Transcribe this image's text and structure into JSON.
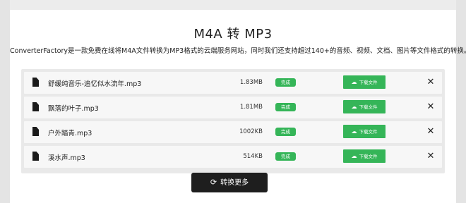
{
  "page": {
    "title": "M4A 转 MP3",
    "subtitle": "ConverterFactory是一款免费在线将M4A文件转换为MP3格式的云端服务网站，同时我们还支持超过140+的音频、视频、文档、图片等文件格式的转换。"
  },
  "files": [
    {
      "name": "舒缓纯音乐-追忆似水流年.mp3",
      "size": "1.83MB",
      "status": "完成",
      "download_label": "下载文件"
    },
    {
      "name": "飘落的叶子.mp3",
      "size": "1.81MB",
      "status": "完成",
      "download_label": "下载文件"
    },
    {
      "name": "户外踏青.mp3",
      "size": "1002KB",
      "status": "完成",
      "download_label": "下载文件"
    },
    {
      "name": "溪水声.mp3",
      "size": "514KB",
      "status": "完成",
      "download_label": "下载文件"
    }
  ],
  "icons": {
    "file": "file-icon",
    "download": "cloud-download-icon",
    "close": "close-icon",
    "refresh": "refresh-icon"
  },
  "more_button": {
    "label": "转换更多"
  },
  "colors": {
    "accent": "#35b558",
    "button_dark": "#1e1e1e"
  }
}
